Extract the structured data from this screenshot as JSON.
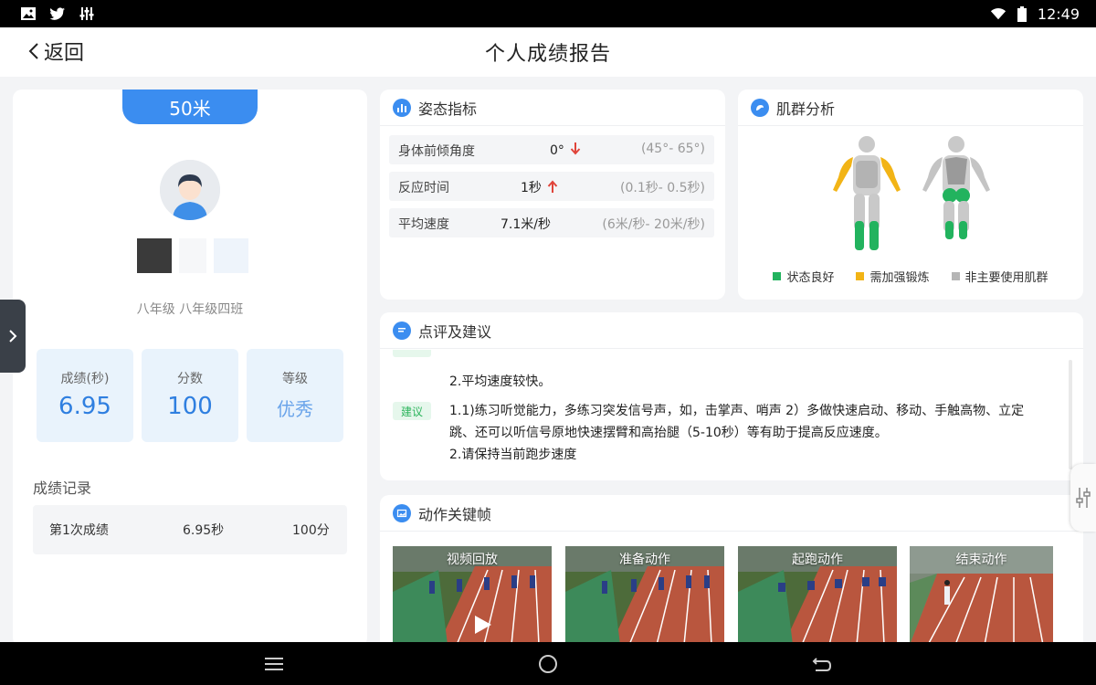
{
  "status_bar": {
    "time": "12:49",
    "left_icons": [
      "image-icon",
      "twitter-icon",
      "equalizer-icon"
    ],
    "right_icons": [
      "wifi-icon",
      "battery-icon"
    ]
  },
  "header": {
    "back_label": "返回",
    "title": "个人成绩报告"
  },
  "student": {
    "event": "50米",
    "class_info": "八年级 八年级四班",
    "stats": [
      {
        "label": "成绩(秒)",
        "value": "6.95"
      },
      {
        "label": "分数",
        "value": "100"
      },
      {
        "label": "等级",
        "value": "优秀"
      }
    ],
    "records_title": "成绩记录",
    "records": [
      {
        "name": "第1次成绩",
        "time": "6.95秒",
        "score": "100分"
      }
    ]
  },
  "posture": {
    "title": "姿态指标",
    "rows": [
      {
        "name": "身体前倾角度",
        "value": "0°",
        "trend": "down",
        "range": "(45°- 65°)"
      },
      {
        "name": "反应时间",
        "value": "1秒",
        "trend": "up",
        "range": "(0.1秒- 0.5秒)"
      },
      {
        "name": "平均速度",
        "value": "7.1米/秒",
        "trend": "",
        "range": "(6米/秒- 20米/秒)"
      }
    ]
  },
  "muscle": {
    "title": "肌群分析",
    "legend": [
      {
        "label": "状态良好",
        "color": "#22b35e"
      },
      {
        "label": "需加强锻炼",
        "color": "#f2b416"
      },
      {
        "label": "非主要使用肌群",
        "color": "#b5b5b5"
      }
    ]
  },
  "comment": {
    "title": "点评及建议",
    "line_partial": "2.平均速度较快。",
    "suggest_tag": "建议",
    "suggest_lines": [
      "1.1)练习听觉能力，多练习突发信号声，如，击掌声、哨声 2）多做快速启动、移动、手触高物、立定",
      "跳、还可以听信号原地快速摆臂和高抬腿（5-10秒）等有助于提高反应速度。",
      "2.请保持当前跑步速度"
    ]
  },
  "keyframes": {
    "title": "动作关键帧",
    "items": [
      "视频回放",
      "准备动作",
      "起跑动作",
      "结束动作"
    ]
  },
  "colors": {
    "accent": "#3b8df0",
    "up_arrow": "#e0443a",
    "down_arrow": "#e0443a",
    "good": "#22b35e",
    "need": "#f2b416",
    "minor": "#b5b5b5"
  }
}
